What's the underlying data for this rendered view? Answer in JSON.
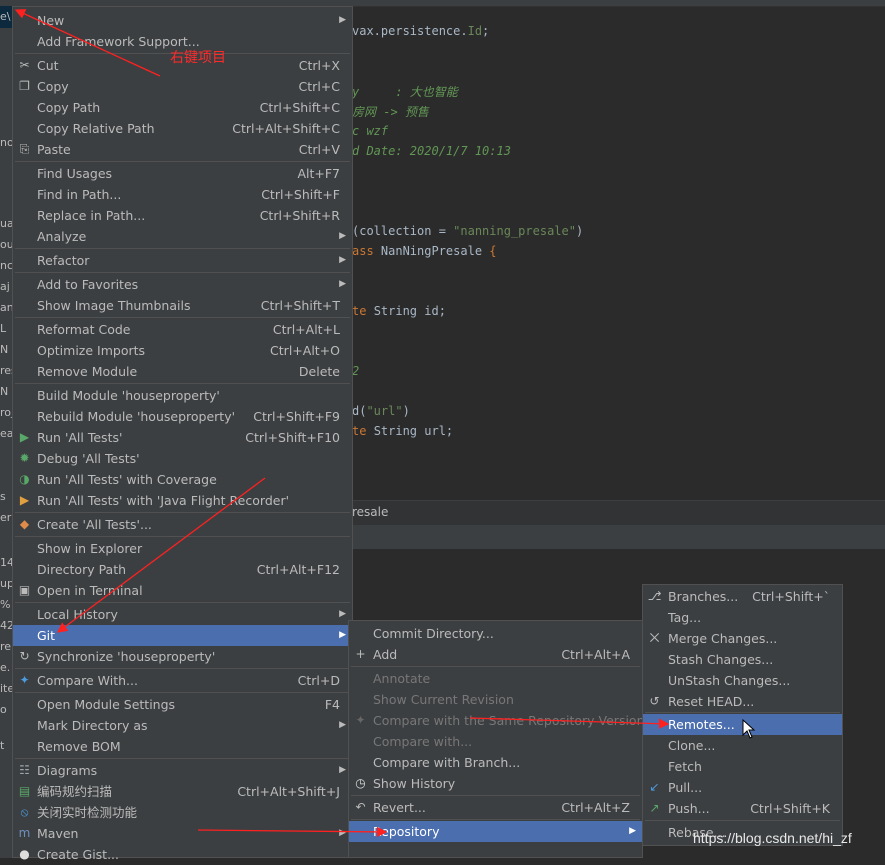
{
  "left_panel": {
    "fragments": [
      "e\\",
      "no",
      "ua",
      "ou",
      "nc",
      "aj",
      "an",
      "L",
      "N",
      "res",
      "N",
      "roj",
      "eal",
      "s",
      "er",
      "14",
      "up",
      "%",
      "42",
      "re",
      "e.",
      "ite",
      "o",
      "t"
    ]
  },
  "editor": {
    "lines": [
      {
        "segments": [
          {
            "t": "vax.persistence.",
            "c": ""
          },
          {
            "t": "Id",
            "c": "str"
          },
          {
            "t": ";",
            "c": ""
          }
        ]
      },
      {
        "segments": [
          {
            "t": "y     : 大也智能",
            "c": "cmt"
          }
        ]
      },
      {
        "segments": [
          {
            "t": "房网 -> 预售",
            "c": "cmt"
          }
        ]
      },
      {
        "segments": [
          {
            "t": "c wzf",
            "c": "cmt"
          }
        ]
      },
      {
        "segments": [
          {
            "t": "d Date: 2020/1/7 10:13",
            "c": "cmt"
          }
        ]
      },
      {
        "segments": [
          {
            "t": "(collection = ",
            "c": ""
          },
          {
            "t": "\"nanning_presale\"",
            "c": "str"
          },
          {
            "t": ")",
            "c": ""
          }
        ]
      },
      {
        "segments": [
          {
            "t": "ass ",
            "c": "kw"
          },
          {
            "t": "NanNingPresale ",
            "c": ""
          },
          {
            "t": "{",
            "c": "kw"
          }
        ]
      },
      {
        "segments": [
          {
            "t": "te ",
            "c": "kw"
          },
          {
            "t": "String id;",
            "c": ""
          }
        ]
      },
      {
        "segments": [
          {
            "t": "2",
            "c": "cmt"
          }
        ]
      },
      {
        "segments": [
          {
            "t": "d(",
            "c": ""
          },
          {
            "t": "\"url\"",
            "c": "str"
          },
          {
            "t": ")",
            "c": ""
          }
        ]
      },
      {
        "segments": [
          {
            "t": "te ",
            "c": "kw"
          },
          {
            "t": "String url;",
            "c": ""
          }
        ]
      }
    ],
    "breadcrumb": "resale"
  },
  "annotation": "右键项目",
  "watermark": "https://blog.csdn.net/hi_zf",
  "colors": {
    "menu_bg": "#3c3f41",
    "selection": "#4b6eaf",
    "arrow": "#ff2020",
    "separator": "#515151"
  },
  "context_menu": {
    "items": [
      {
        "label": "New",
        "shortcut": "",
        "icon": "",
        "submenu": true
      },
      {
        "label": "Add Framework Support...",
        "shortcut": "",
        "icon": ""
      },
      {
        "label": "Cut",
        "shortcut": "Ctrl+X",
        "icon": "scissors-icon"
      },
      {
        "label": "Copy",
        "shortcut": "Ctrl+C",
        "icon": "copy-icon"
      },
      {
        "label": "Copy Path",
        "shortcut": "Ctrl+Shift+C",
        "icon": ""
      },
      {
        "label": "Copy Relative Path",
        "shortcut": "Ctrl+Alt+Shift+C",
        "icon": ""
      },
      {
        "label": "Paste",
        "shortcut": "Ctrl+V",
        "icon": "clipboard-icon"
      },
      {
        "label": "Find Usages",
        "shortcut": "Alt+F7",
        "icon": ""
      },
      {
        "label": "Find in Path...",
        "shortcut": "Ctrl+Shift+F",
        "icon": ""
      },
      {
        "label": "Replace in Path...",
        "shortcut": "Ctrl+Shift+R",
        "icon": ""
      },
      {
        "label": "Analyze",
        "shortcut": "",
        "icon": "",
        "submenu": true
      },
      {
        "label": "Refactor",
        "shortcut": "",
        "icon": "",
        "submenu": true
      },
      {
        "label": "Add to Favorites",
        "shortcut": "",
        "icon": "",
        "submenu": true
      },
      {
        "label": "Show Image Thumbnails",
        "shortcut": "Ctrl+Shift+T",
        "icon": ""
      },
      {
        "label": "Reformat Code",
        "shortcut": "Ctrl+Alt+L",
        "icon": ""
      },
      {
        "label": "Optimize Imports",
        "shortcut": "Ctrl+Alt+O",
        "icon": ""
      },
      {
        "label": "Remove Module",
        "shortcut": "Delete",
        "icon": ""
      },
      {
        "label": "Build Module 'houseproperty'",
        "shortcut": "",
        "icon": ""
      },
      {
        "label": "Rebuild Module 'houseproperty'",
        "shortcut": "Ctrl+Shift+F9",
        "icon": ""
      },
      {
        "label": "Run 'All Tests'",
        "shortcut": "Ctrl+Shift+F10",
        "icon": "run-icon"
      },
      {
        "label": "Debug 'All Tests'",
        "shortcut": "",
        "icon": "debug-icon"
      },
      {
        "label": "Run 'All Tests' with Coverage",
        "shortcut": "",
        "icon": "coverage-icon"
      },
      {
        "label": "Run 'All Tests' with 'Java Flight Recorder'",
        "shortcut": "",
        "icon": "flight-recorder-icon"
      },
      {
        "label": "Create 'All Tests'...",
        "shortcut": "",
        "icon": "create-test-icon"
      },
      {
        "label": "Show in Explorer",
        "shortcut": "",
        "icon": ""
      },
      {
        "label": "Directory Path",
        "shortcut": "Ctrl+Alt+F12",
        "icon": ""
      },
      {
        "label": "Open in Terminal",
        "shortcut": "",
        "icon": "terminal-icon"
      },
      {
        "label": "Local History",
        "shortcut": "",
        "icon": "",
        "submenu": true
      },
      {
        "label": "Git",
        "shortcut": "",
        "icon": "",
        "submenu": true,
        "selected": true
      },
      {
        "label": "Synchronize 'houseproperty'",
        "shortcut": "",
        "icon": "sync-icon"
      },
      {
        "label": "Compare With...",
        "shortcut": "Ctrl+D",
        "icon": "compare-icon"
      },
      {
        "label": "Open Module Settings",
        "shortcut": "F4",
        "icon": ""
      },
      {
        "label": "Mark Directory as",
        "shortcut": "",
        "icon": "",
        "submenu": true
      },
      {
        "label": "Remove BOM",
        "shortcut": "",
        "icon": ""
      },
      {
        "label": "Diagrams",
        "shortcut": "",
        "icon": "diagram-icon",
        "submenu": true
      },
      {
        "label": "编码规约扫描",
        "shortcut": "Ctrl+Alt+Shift+J",
        "icon": "scan-icon"
      },
      {
        "label": "关闭实时检测功能",
        "shortcut": "",
        "icon": "disable-icon"
      },
      {
        "label": "Maven",
        "shortcut": "",
        "icon": "maven-icon",
        "submenu": true
      },
      {
        "label": "Create Gist...",
        "shortcut": "",
        "icon": "github-icon"
      }
    ]
  },
  "git_menu": {
    "items": [
      {
        "label": "Commit Directory...",
        "shortcut": "",
        "icon": ""
      },
      {
        "label": "Add",
        "shortcut": "Ctrl+Alt+A",
        "icon": "plus-icon"
      },
      {
        "label": "Annotate",
        "shortcut": "",
        "icon": "",
        "disabled": true
      },
      {
        "label": "Show Current Revision",
        "shortcut": "",
        "icon": "",
        "disabled": true
      },
      {
        "label": "Compare with the Same Repository Version",
        "shortcut": "",
        "icon": "compare-icon",
        "disabled": true
      },
      {
        "label": "Compare with...",
        "shortcut": "",
        "icon": "",
        "disabled": true
      },
      {
        "label": "Compare with Branch...",
        "shortcut": "",
        "icon": ""
      },
      {
        "label": "Show History",
        "shortcut": "",
        "icon": "history-icon"
      },
      {
        "label": "Revert...",
        "shortcut": "Ctrl+Alt+Z",
        "icon": "revert-icon"
      },
      {
        "label": "Repository",
        "shortcut": "",
        "icon": "",
        "submenu": true,
        "selected": true
      }
    ]
  },
  "repository_menu": {
    "items": [
      {
        "label": "Branches...",
        "shortcut": "Ctrl+Shift+`",
        "icon": "branch-icon"
      },
      {
        "label": "Tag...",
        "shortcut": "",
        "icon": ""
      },
      {
        "label": "Merge Changes...",
        "shortcut": "",
        "icon": "merge-icon"
      },
      {
        "label": "Stash Changes...",
        "shortcut": "",
        "icon": ""
      },
      {
        "label": "UnStash Changes...",
        "shortcut": "",
        "icon": ""
      },
      {
        "label": "Reset HEAD...",
        "shortcut": "",
        "icon": "reset-icon"
      },
      {
        "label": "Remotes...",
        "shortcut": "",
        "icon": "",
        "selected": true
      },
      {
        "label": "Clone...",
        "shortcut": "",
        "icon": ""
      },
      {
        "label": "Fetch",
        "shortcut": "",
        "icon": ""
      },
      {
        "label": "Pull...",
        "shortcut": "",
        "icon": "pull-icon"
      },
      {
        "label": "Push...",
        "shortcut": "Ctrl+Shift+K",
        "icon": "push-icon"
      },
      {
        "label": "Rebase...",
        "shortcut": "",
        "icon": ""
      }
    ]
  }
}
